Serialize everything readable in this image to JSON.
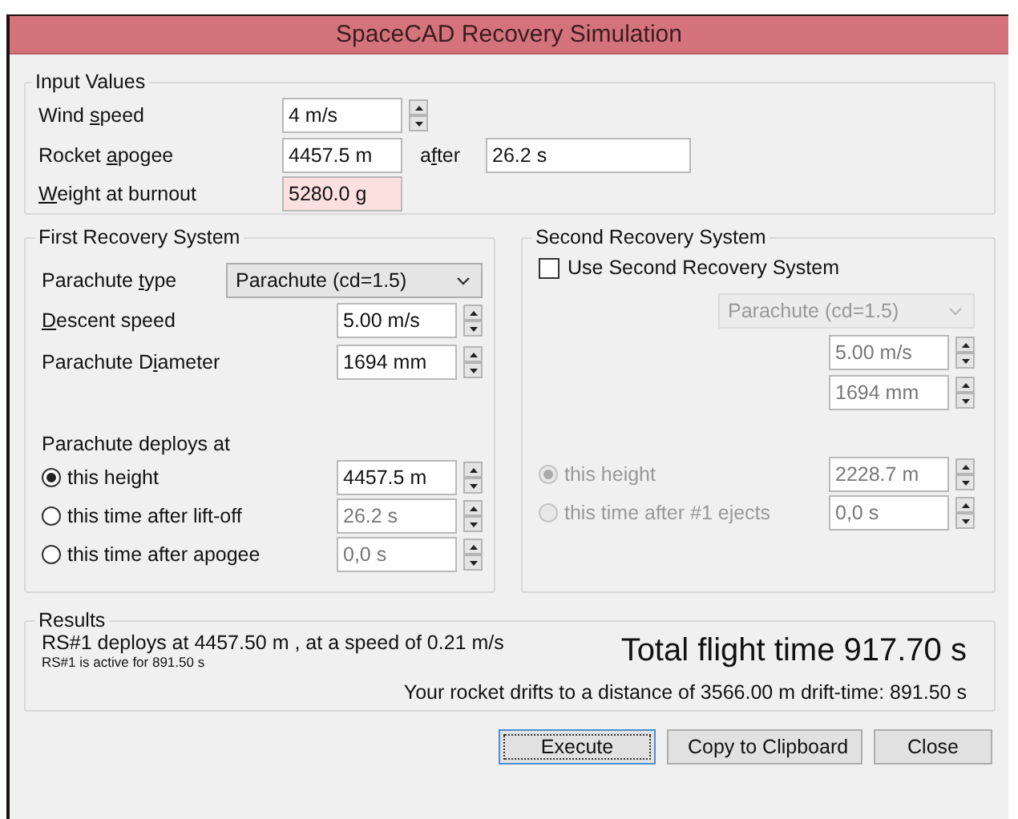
{
  "window": {
    "title": "SpaceCAD Recovery Simulation"
  },
  "input_values": {
    "title": "Input Values",
    "rows": [
      {
        "kind": "spinner",
        "label": {
          "lead": "Wind ",
          "key": "s",
          "rest": "peed"
        },
        "value": "4 m/s",
        "invalid": false
      },
      {
        "kind": "pair",
        "label": {
          "lead": "Rocket ",
          "key": "a",
          "rest": "pogee"
        },
        "value": "4457.5 m",
        "invalid": false,
        "after_label": {
          "lead": "a",
          "key": "f",
          "rest": "ter"
        },
        "after_value": "26.2 s"
      },
      {
        "kind": "plain",
        "label": {
          "key": "W",
          "rest": "eight at burnout"
        },
        "value": "5280.0 g",
        "invalid": true
      }
    ]
  },
  "first_recovery": {
    "title": "First Recovery System",
    "type_label": {
      "lead": "Parachute ",
      "key": "t",
      "rest": "ype"
    },
    "type_value": "Parachute (cd=1.5)",
    "descent_label": {
      "key": "D",
      "rest": "escent speed"
    },
    "descent_value": "5.00 m/s",
    "diameter_label": {
      "lead": "Parachute D",
      "key": "i",
      "rest": "ameter"
    },
    "diameter_value": "1694 mm",
    "deploy_title": "Parachute deploys at",
    "deploy_options": [
      {
        "label": "this height",
        "selected": true,
        "value": "4457.5 m",
        "disabled": false
      },
      {
        "label": "this time after lift-off",
        "selected": false,
        "value": "26.2 s",
        "disabled": true
      },
      {
        "label": "this time after apogee",
        "selected": false,
        "value": "0,0 s",
        "disabled": true
      }
    ]
  },
  "second_recovery": {
    "title": "Second Recovery System",
    "use_checkbox": {
      "label": "Use Second Recovery System",
      "checked": false
    },
    "disabled": true,
    "type_value": "Parachute (cd=1.5)",
    "descent_value": "5.00 m/s",
    "diameter_value": "1694 mm",
    "deploy_options": [
      {
        "label": "this height",
        "selected": true,
        "value": "2228.7 m"
      },
      {
        "label": "this time after #1 ejects",
        "selected": false,
        "value": "0,0 s"
      }
    ]
  },
  "results": {
    "title": "Results",
    "deploy_line": "RS#1 deploys at 4457.50 m , at a speed of 0.21 m/s",
    "active_line": "RS#1 is active for 891.50 s",
    "total": "Total flight time 917.70 s",
    "drift": "Your rocket drifts to a distance of 3566.00 m drift-time: 891.50 s"
  },
  "buttons": [
    {
      "label": "Execute",
      "focused": true
    },
    {
      "label": "Copy to Clipboard",
      "focused": false
    },
    {
      "label": "Close",
      "focused": false
    }
  ]
}
